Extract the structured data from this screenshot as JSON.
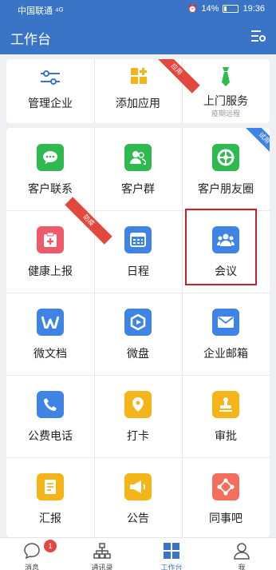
{
  "status_bar": {
    "carrier": "中国联通 ⁴ᴳ",
    "battery": "14%",
    "time": "19:36"
  },
  "header": {
    "title": "工作台"
  },
  "top_card": {
    "items": [
      {
        "label": "管理企业",
        "icon": "sliders-icon"
      },
      {
        "label": "添加应用",
        "icon": "add-app-icon",
        "ribbon": "应用"
      },
      {
        "label": "上门服务",
        "sublabel": "疫期远程",
        "icon": "tie-icon"
      }
    ]
  },
  "apps": [
    {
      "label": "客户联系",
      "icon": "chat-bubble-icon",
      "color": "#2fb94f"
    },
    {
      "label": "客户群",
      "icon": "customer-group-icon",
      "color": "#2fb94f"
    },
    {
      "label": "客户朋友圈",
      "icon": "aperture-icon",
      "color": "#2fb94f",
      "ribbon": "试用"
    },
    {
      "label": "健康上报",
      "icon": "health-report-icon",
      "color": "#ef5a6a",
      "ribbon": "防疫"
    },
    {
      "label": "日程",
      "icon": "calendar-icon",
      "color": "#3f84e5"
    },
    {
      "label": "会议",
      "icon": "meeting-icon",
      "color": "#3f84e5"
    },
    {
      "label": "微文档",
      "icon": "doc-w-icon",
      "color": "#3f84e5"
    },
    {
      "label": "微盘",
      "icon": "drive-icon",
      "color": "#3f84e5"
    },
    {
      "label": "企业邮箱",
      "icon": "mail-icon",
      "color": "#3f84e5"
    },
    {
      "label": "公费电话",
      "icon": "phone-icon",
      "color": "#3f84e5"
    },
    {
      "label": "打卡",
      "icon": "location-pin-icon",
      "color": "#f3b519"
    },
    {
      "label": "审批",
      "icon": "stamp-icon",
      "color": "#f3b519"
    },
    {
      "label": "汇报",
      "icon": "report-icon",
      "color": "#f3b519"
    },
    {
      "label": "公告",
      "icon": "megaphone-icon",
      "color": "#f3b519"
    },
    {
      "label": "同事吧",
      "icon": "share-icon",
      "color": "#f16f5c"
    }
  ],
  "tabs": [
    {
      "label": "消息",
      "badge": "1"
    },
    {
      "label": "通讯录"
    },
    {
      "label": "工作台"
    },
    {
      "label": "我"
    }
  ],
  "colors": {
    "brand": "#3a74c6",
    "active_tab": "#3a74c6",
    "highlight": "#c8202a"
  }
}
